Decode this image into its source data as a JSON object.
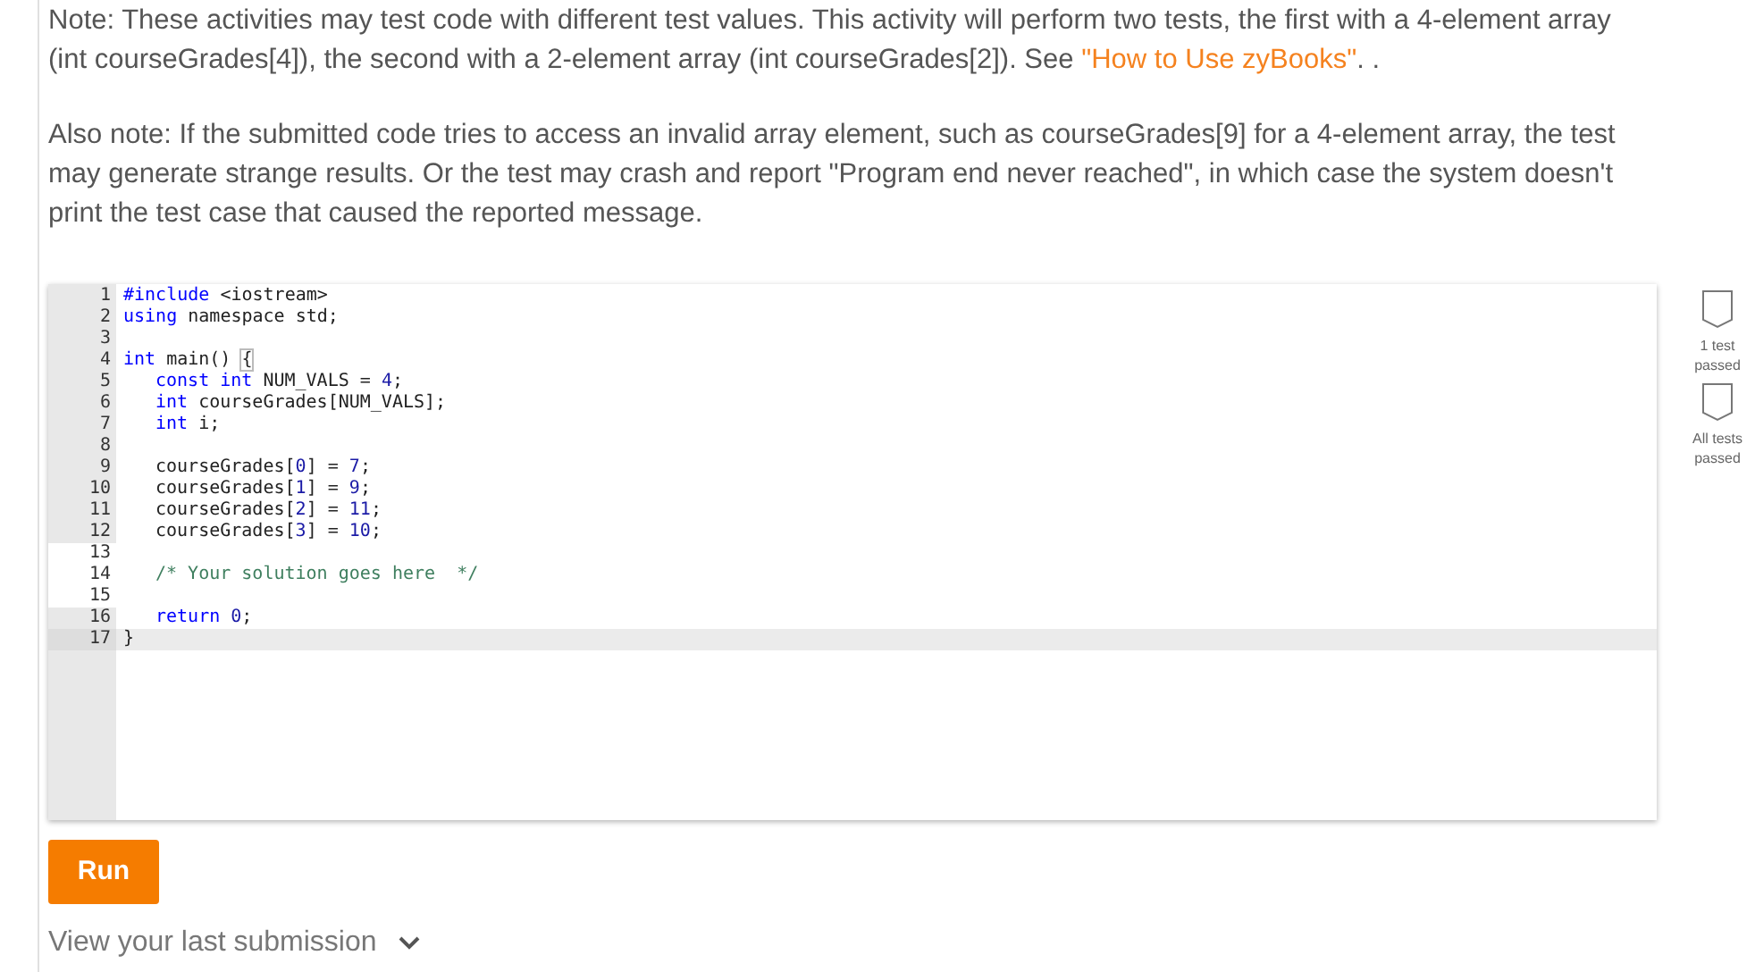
{
  "instructions": [
    {
      "text": "Note: These activities may test code with different test values. This activity will perform two tests, the first with a 4-element array (int courseGrades[4]), the second with a 2-element array (int courseGrades[2]). See ",
      "link": "\"How to Use zyBooks\"",
      "after": ". ."
    },
    {
      "text": "Also note: If the submitted code tries to access an invalid array element, such as courseGrades[9] for a 4-element array, the test may generate strange results. Or the test may crash and report \"Program end never reached\", in which case the system doesn't print the test case that caused the reported message."
    }
  ],
  "editor": {
    "lines": [
      {
        "number": "1",
        "editable": false,
        "active": false,
        "indented": false,
        "tokens": [
          {
            "kind": "keyword",
            "text": "#include"
          },
          {
            "kind": "plain",
            "text": " <iostream>"
          }
        ]
      },
      {
        "number": "2",
        "editable": false,
        "active": false,
        "indented": false,
        "tokens": [
          {
            "kind": "keyword",
            "text": "using"
          },
          {
            "kind": "plain",
            "text": " namespace std;"
          }
        ]
      },
      {
        "number": "3",
        "editable": false,
        "active": false,
        "indented": false
      },
      {
        "number": "4",
        "editable": false,
        "active": false,
        "indented": false,
        "tokens": [
          {
            "kind": "keyword",
            "text": "int"
          },
          {
            "kind": "plain",
            "text": " main() "
          },
          {
            "kind": "bracket",
            "text": "{"
          }
        ]
      },
      {
        "number": "5",
        "editable": false,
        "active": false,
        "indented": true,
        "tokens": [
          {
            "kind": "keyword",
            "text": "const int"
          },
          {
            "kind": "plain",
            "text": " NUM_VALS = "
          },
          {
            "kind": "number",
            "text": "4"
          },
          {
            "kind": "plain",
            "text": ";"
          }
        ]
      },
      {
        "number": "6",
        "editable": false,
        "active": false,
        "indented": true,
        "tokens": [
          {
            "kind": "keyword",
            "text": "int"
          },
          {
            "kind": "plain",
            "text": " courseGrades[NUM_VALS];"
          }
        ]
      },
      {
        "number": "7",
        "editable": false,
        "active": false,
        "indented": true,
        "tokens": [
          {
            "kind": "keyword",
            "text": "int"
          },
          {
            "kind": "plain",
            "text": " i;"
          }
        ]
      },
      {
        "number": "8",
        "editable": false,
        "active": false,
        "indented": false
      },
      {
        "number": "9",
        "editable": false,
        "active": false,
        "indented": true,
        "tokens": [
          {
            "kind": "plain",
            "text": "courseGrades["
          },
          {
            "kind": "number",
            "text": "0"
          },
          {
            "kind": "plain",
            "text": "] = "
          },
          {
            "kind": "number",
            "text": "7"
          },
          {
            "kind": "plain",
            "text": ";"
          }
        ]
      },
      {
        "number": "10",
        "editable": false,
        "active": false,
        "indented": true,
        "tokens": [
          {
            "kind": "plain",
            "text": "courseGrades["
          },
          {
            "kind": "number",
            "text": "1"
          },
          {
            "kind": "plain",
            "text": "] = "
          },
          {
            "kind": "number",
            "text": "9"
          },
          {
            "kind": "plain",
            "text": ";"
          }
        ]
      },
      {
        "number": "11",
        "editable": false,
        "active": false,
        "indented": true,
        "tokens": [
          {
            "kind": "plain",
            "text": "courseGrades["
          },
          {
            "kind": "number",
            "text": "2"
          },
          {
            "kind": "plain",
            "text": "] = "
          },
          {
            "kind": "number",
            "text": "11"
          },
          {
            "kind": "plain",
            "text": ";"
          }
        ]
      },
      {
        "number": "12",
        "editable": false,
        "active": false,
        "indented": true,
        "tokens": [
          {
            "kind": "plain",
            "text": "courseGrades["
          },
          {
            "kind": "number",
            "text": "3"
          },
          {
            "kind": "plain",
            "text": "] = "
          },
          {
            "kind": "number",
            "text": "10"
          },
          {
            "kind": "plain",
            "text": ";"
          }
        ]
      },
      {
        "number": "13",
        "editable": true,
        "active": false,
        "indented": false
      },
      {
        "number": "14",
        "editable": true,
        "active": false,
        "indented": true,
        "tokens": [
          {
            "kind": "comment",
            "text": "/* Your solution goes here  */"
          }
        ]
      },
      {
        "number": "15",
        "editable": true,
        "active": false,
        "indented": false
      },
      {
        "number": "16",
        "editable": false,
        "active": false,
        "indented": true,
        "tokens": [
          {
            "kind": "keyword",
            "text": "return"
          },
          {
            "kind": "number",
            "text": " 0"
          },
          {
            "kind": "plain",
            "text": ";"
          }
        ]
      },
      {
        "number": "17",
        "editable": false,
        "active": true,
        "indented": false,
        "tokens": [
          {
            "kind": "plain",
            "text": "}"
          }
        ]
      }
    ]
  },
  "tests": [
    {
      "label": "1 test passed",
      "passed": false
    },
    {
      "label": "All tests passed",
      "passed": false
    }
  ],
  "run_button": "Run",
  "last_submission": {
    "label": "View your last submission",
    "expanded": false
  }
}
